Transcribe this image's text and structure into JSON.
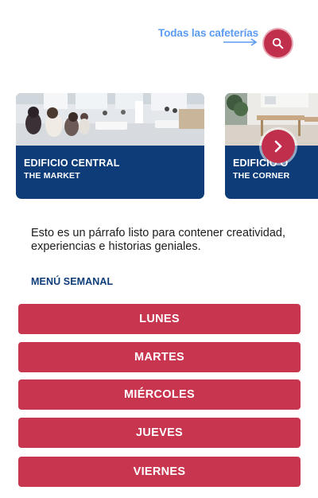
{
  "header": {
    "all_cafes_label": "Todas las cafeterías",
    "search_icon": "search-icon"
  },
  "cards": [
    {
      "title": "EDIFICIO CENTRAL",
      "subtitle": "THE MARKET"
    },
    {
      "title": "EDIFICIO O",
      "subtitle": "THE CORNER"
    }
  ],
  "carousel": {
    "next_icon": "chevron-right-icon"
  },
  "intro": {
    "text": "Esto es un párrafo listo para contener creatividad, experiencias e historias geniales."
  },
  "weekly_menu": {
    "title": "MENÚ SEMANAL",
    "days": [
      "LUNES",
      "MARTES",
      "MIÉRCOLES",
      "JUEVES",
      "VIERNES"
    ]
  },
  "colors": {
    "brand_red": "#c7354f",
    "brand_navy": "#0d3c78",
    "link_blue": "#5b9bf0"
  }
}
